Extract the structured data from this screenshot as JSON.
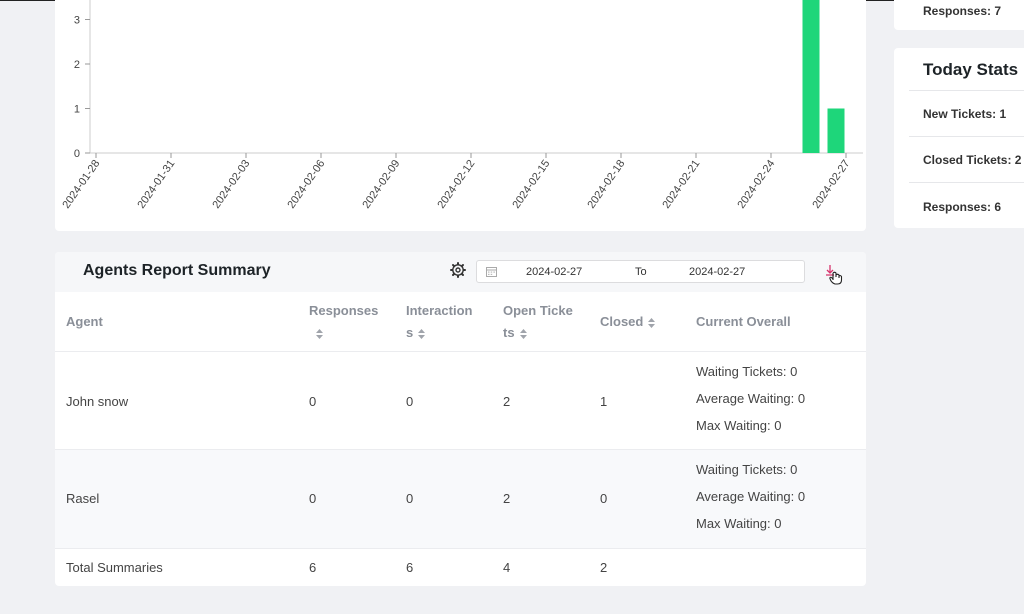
{
  "chart_data": {
    "type": "bar",
    "categories": [
      "2024-01-28",
      "2024-01-31",
      "2024-02-03",
      "2024-02-06",
      "2024-02-09",
      "2024-02-12",
      "2024-02-15",
      "2024-02-18",
      "2024-02-21",
      "2024-02-24",
      "2024-02-27"
    ],
    "bars": [
      {
        "date": "2024-02-26",
        "value": 4
      },
      {
        "date": "2024-02-27",
        "value": 1
      }
    ],
    "yticks": [
      "0",
      "1",
      "2",
      "3"
    ],
    "ylim": [
      0,
      3.35
    ],
    "color": "#1ed67a"
  },
  "side": {
    "top_responses": "Responses: 7",
    "today_title": "Today Stats",
    "new_tickets": "New Tickets: 1",
    "closed_tickets": "Closed Tickets: 2",
    "responses": "Responses: 6"
  },
  "report": {
    "title": "Agents Report Summary",
    "date_start": "2024-02-27",
    "date_to": "To",
    "date_end": "2024-02-27",
    "headers": {
      "agent": "Agent",
      "responses": "Responses",
      "interactions_1": "Interaction",
      "interactions_2": "s",
      "open_1": "Open Ticke",
      "open_2": "ts",
      "closed": "Closed",
      "current": "Current Overall"
    },
    "rows": [
      {
        "agent": "John snow",
        "responses": "0",
        "interactions": "0",
        "open": "2",
        "closed": "1",
        "waiting": "Waiting Tickets: 0",
        "avg": "Average Waiting: 0",
        "max": "Max Waiting: 0"
      },
      {
        "agent": "Rasel",
        "responses": "0",
        "interactions": "0",
        "open": "2",
        "closed": "0",
        "waiting": "Waiting Tickets: 0",
        "avg": "Average Waiting: 0",
        "max": "Max Waiting: 0"
      }
    ],
    "total": {
      "label": "Total Summaries",
      "responses": "6",
      "interactions": "6",
      "open": "4",
      "closed": "2"
    }
  },
  "icons": {
    "gear": "gear-icon",
    "calendar": "calendar-icon",
    "download": "download-icon",
    "sort": "sort-icon"
  },
  "colors": {
    "bar": "#1ed67a",
    "download": "#d6336c"
  }
}
